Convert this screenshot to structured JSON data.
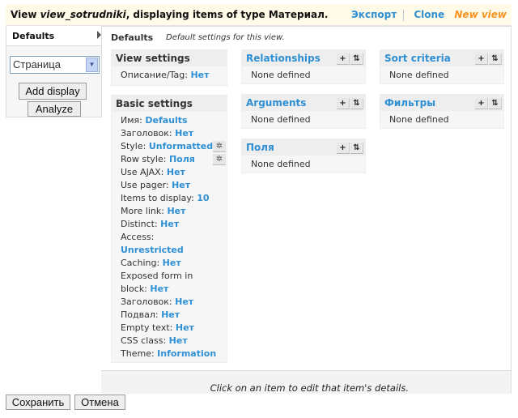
{
  "header": {
    "title_prefix": "View ",
    "view_name": "view_sotrudniki",
    "title_suffix": ", displaying items of type Материал.",
    "export": "Экспорт",
    "clone": "Clone",
    "new_view": "New view"
  },
  "sidebar": {
    "tab": "Defaults",
    "select_value": "Страница",
    "add_display": "Add display",
    "analyze": "Analyze"
  },
  "main": {
    "display_title": "Defaults",
    "display_desc": "Default settings for this view.",
    "view_settings": {
      "title": "View settings",
      "items": [
        {
          "label": "Описание/Tag: ",
          "value": "Нет"
        }
      ]
    },
    "basic_settings": {
      "title": "Basic settings",
      "items": [
        {
          "label": "Имя: ",
          "value": "Defaults"
        },
        {
          "label": "Заголовок: ",
          "value": "Нет"
        },
        {
          "label": "Style: ",
          "value": "Unformatted",
          "gear": true
        },
        {
          "label": "Row style: ",
          "value": "Поля",
          "gear": true
        },
        {
          "label": "Use AJAX: ",
          "value": "Нет"
        },
        {
          "label": "Use pager: ",
          "value": "Нет"
        },
        {
          "label": "Items to display: ",
          "value": "10"
        },
        {
          "label": "More link: ",
          "value": "Нет"
        },
        {
          "label": "Distinct: ",
          "value": "Нет"
        },
        {
          "label": "Access: ",
          "value": "Unrestricted"
        },
        {
          "label": "Caching: ",
          "value": "Нет"
        },
        {
          "label": "Exposed form in block: ",
          "value": "Нет"
        },
        {
          "label": "Заголовок: ",
          "value": "Нет"
        },
        {
          "label": "Подвал: ",
          "value": "Нет"
        },
        {
          "label": "Empty text: ",
          "value": "Нет"
        },
        {
          "label": "CSS class: ",
          "value": "Нет"
        },
        {
          "label": "Theme: ",
          "value": "Information"
        }
      ]
    },
    "relationships": {
      "title": "Relationships",
      "empty": "None defined"
    },
    "arguments": {
      "title": "Arguments",
      "empty": "None defined"
    },
    "fields": {
      "title": "Поля",
      "empty": "None defined"
    },
    "sort": {
      "title": "Sort criteria",
      "empty": "None defined"
    },
    "filters": {
      "title": "Фильтры",
      "empty": "None defined"
    },
    "footer_hint": "Click on an item to edit that item's details."
  },
  "actions": {
    "save": "Сохранить",
    "cancel": "Отмена"
  },
  "colors": {
    "link": "#2f8fd3",
    "new_view": "#f7931e",
    "header_bg": "#fffbe8"
  }
}
